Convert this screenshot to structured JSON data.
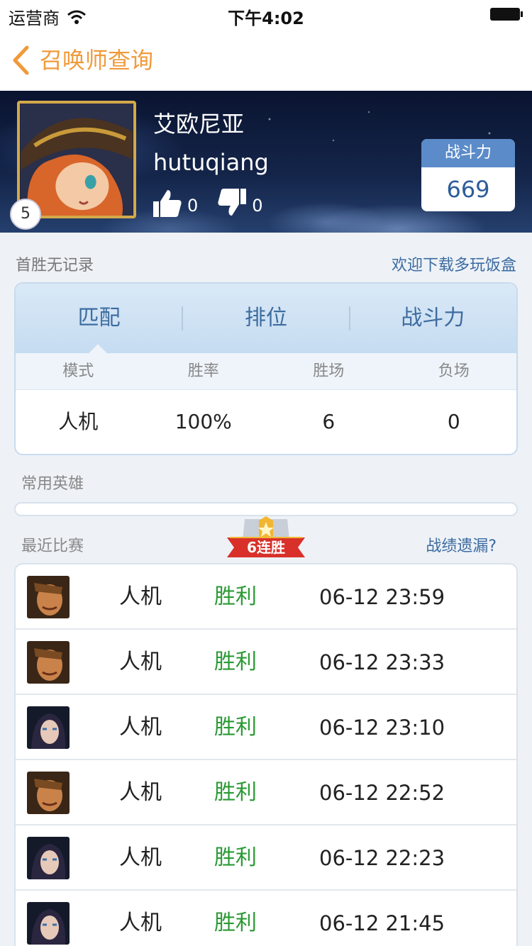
{
  "status_bar": {
    "carrier": "运营商",
    "time": "下午4:02"
  },
  "nav": {
    "title": "召唤师查询"
  },
  "profile": {
    "name": "艾欧尼亚",
    "id": "hutuqiang",
    "level": "5",
    "likes": "0",
    "dislikes": "0",
    "power_label": "战斗力",
    "power_value": "669"
  },
  "info": {
    "first_win": "首胜无记录",
    "download": "欢迎下载多玩饭盒"
  },
  "stats": {
    "tabs": [
      "匹配",
      "排位",
      "战斗力"
    ],
    "headers": [
      "模式",
      "胜率",
      "胜场",
      "负场"
    ],
    "row": [
      "人机",
      "100%",
      "6",
      "0"
    ]
  },
  "heroes_label": "常用英雄",
  "recent": {
    "label": "最近比赛",
    "streak": "6连胜",
    "missing": "战绩遗漏?",
    "matches": [
      {
        "mode": "人机",
        "result": "胜利",
        "time": "06-12 23:59",
        "hero": "warrior-hero-icon"
      },
      {
        "mode": "人机",
        "result": "胜利",
        "time": "06-12 23:33",
        "hero": "warrior-hero-icon"
      },
      {
        "mode": "人机",
        "result": "胜利",
        "time": "06-12 23:10",
        "hero": "dark-hero-icon"
      },
      {
        "mode": "人机",
        "result": "胜利",
        "time": "06-12 22:52",
        "hero": "warrior-hero-icon"
      },
      {
        "mode": "人机",
        "result": "胜利",
        "time": "06-12 22:23",
        "hero": "dark-hero-icon"
      },
      {
        "mode": "人机",
        "result": "胜利",
        "time": "06-12 21:45",
        "hero": "dark-hero-icon"
      }
    ]
  },
  "colors": {
    "accent": "#f09a3a",
    "win": "#2a9a34",
    "link": "#3b6aa0"
  }
}
